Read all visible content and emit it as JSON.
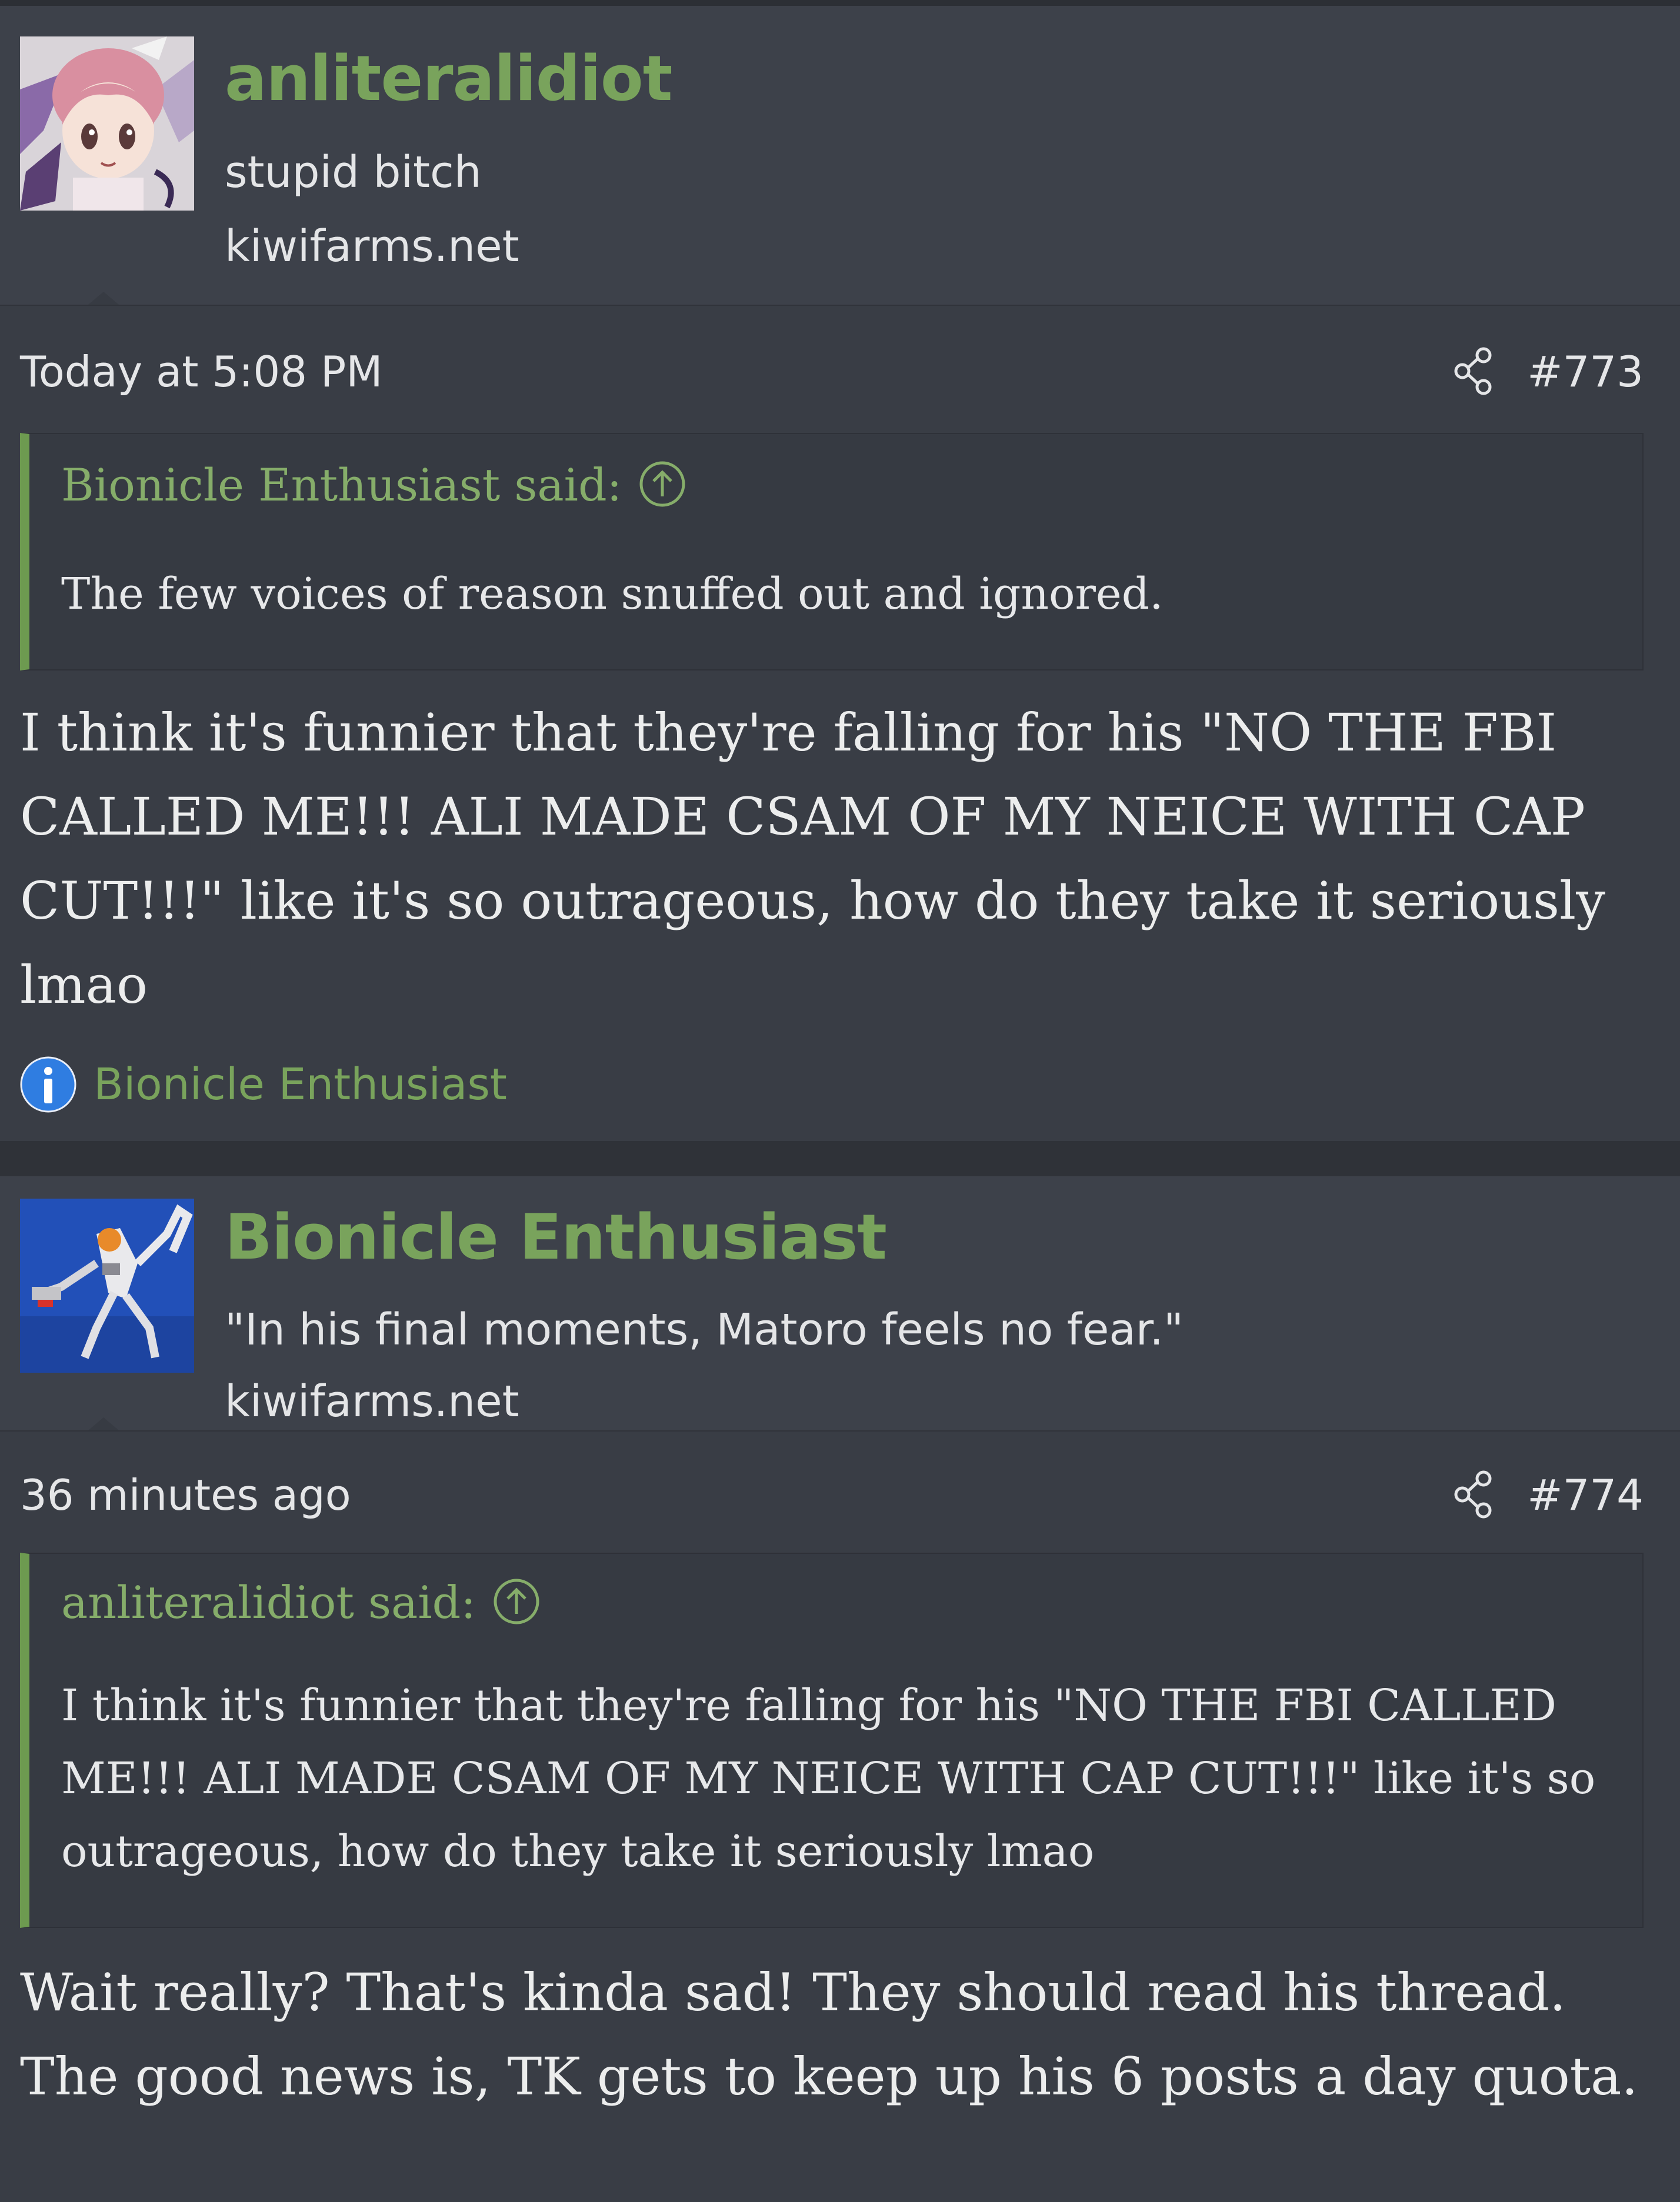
{
  "posts": [
    {
      "author": "anliteralidiot",
      "author_title": "stupid bitch",
      "author_domain": "kiwifarms.net",
      "avatar": "anime-girl-avatar",
      "timestamp": "Today at 5:08 PM",
      "post_number": "#773",
      "quote": {
        "attribution": "Bionicle Enthusiast said:",
        "text": "The few voices of reason snuffed out and ignored."
      },
      "body": "I think it's funnier that they're falling for his \"NO THE FBI CALLED ME!!! ALI MADE CSAM OF MY NEICE WITH CAP CUT!!!\" like it's so outrageous, how do they take it seriously lmao",
      "reaction": {
        "icon": "info-icon",
        "user": "Bionicle Enthusiast"
      }
    },
    {
      "author": "Bionicle Enthusiast",
      "author_title": "\"In his final moments, Matoro feels no fear.\"",
      "author_domain": "kiwifarms.net",
      "avatar": "bionicle-figure-avatar",
      "timestamp": "36 minutes ago",
      "post_number": "#774",
      "quote": {
        "attribution": "anliteralidiot said:",
        "text": "I think it's funnier that they're falling for his \"NO THE FBI CALLED ME!!! ALI MADE CSAM OF MY NEICE WITH CAP CUT!!!\" like it's so outrageous, how do they take it seriously lmao"
      },
      "body": "Wait really? That's kinda sad! They should read his thread. The good news is, TK gets to keep up his 6 posts a day quota."
    }
  ],
  "colors": {
    "accent_green": "#79a35c",
    "quote_border": "#6d9a50",
    "background": "#393d45",
    "info_blue": "#2f7de1"
  }
}
